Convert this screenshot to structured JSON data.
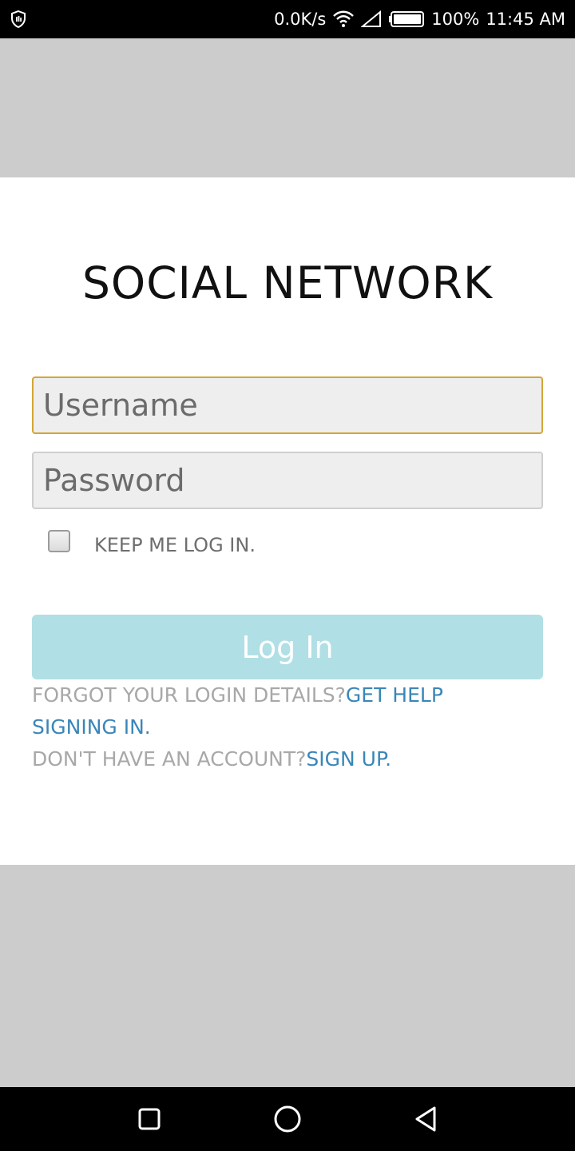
{
  "status_bar": {
    "net_speed": "0.0K/s",
    "battery": "100%",
    "time": "11:45 AM",
    "icons": [
      "shield-icon",
      "wifi-icon",
      "signal-icon",
      "battery-icon"
    ]
  },
  "login": {
    "title": "SOCIAL NETWORK",
    "username_placeholder": "Username",
    "password_placeholder": "Password",
    "keep_logged_in_label": "KEEP ME LOG IN.",
    "login_button_label": "Log In",
    "forgot_text": "FORGOT YOUR LOGIN DETAILS?",
    "get_help_link": "GET HELP SIGNING IN.",
    "no_account_text": "DON'T HAVE AN ACCOUNT?",
    "sign_up_link": "SIGN UP."
  },
  "nav_bar": {
    "icons": [
      "square-recent-apps-icon",
      "circle-home-icon",
      "triangle-back-icon"
    ]
  },
  "colors": {
    "focus_border": "#d4a637",
    "button_bg": "#b0dfe5",
    "link": "#3a86b8",
    "muted_text": "#a8a8a8",
    "background_gray": "#cccccc"
  }
}
